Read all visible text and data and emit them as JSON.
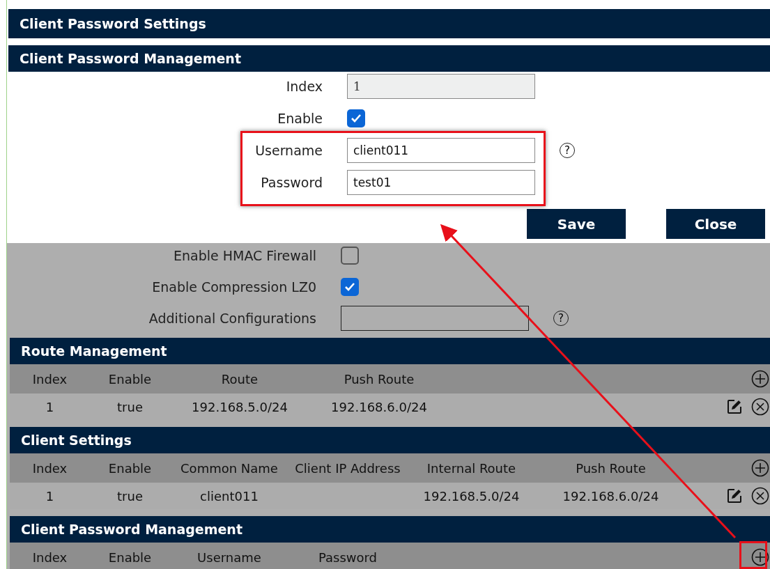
{
  "dialog": {
    "title": "Client Password Settings",
    "section": "Client Password Management",
    "fields": [
      {
        "kind": "text",
        "label": "Index",
        "value": "1",
        "disabled": true
      },
      {
        "kind": "checkbox",
        "label": "Enable",
        "checked": true
      },
      {
        "kind": "text",
        "label": "Username",
        "value": "client011",
        "disabled": false,
        "help": "?"
      },
      {
        "kind": "text",
        "label": "Password",
        "value": "test01",
        "disabled": false
      }
    ],
    "buttons": [
      "Save",
      "Close"
    ]
  },
  "settings": [
    {
      "kind": "checkbox",
      "label": "Enable HMAC Firewall",
      "checked": false
    },
    {
      "kind": "checkbox",
      "label": "Enable Compression LZ0",
      "checked": true
    },
    {
      "kind": "text",
      "label": "Additional Configurations",
      "disabled": false,
      "help": "?"
    }
  ],
  "tables": [
    {
      "title": "Route Management",
      "columns": [
        "Index",
        "Enable",
        "Route",
        "Push Route"
      ],
      "rows": [
        [
          "1",
          "true",
          "192.168.5.0/24",
          "192.168.6.0/24"
        ]
      ]
    },
    {
      "title": "Client Settings",
      "columns": [
        "Index",
        "Enable",
        "Common Name",
        "Client IP Address",
        "Internal Route",
        "Push Route"
      ],
      "rows": [
        [
          "1",
          "true",
          "client011",
          null,
          "192.168.5.0/24",
          "192.168.6.0/24"
        ]
      ]
    },
    {
      "title": "Client Password Management",
      "columns": [
        "Index",
        "Enable",
        "Username",
        "Password"
      ]
    }
  ]
}
